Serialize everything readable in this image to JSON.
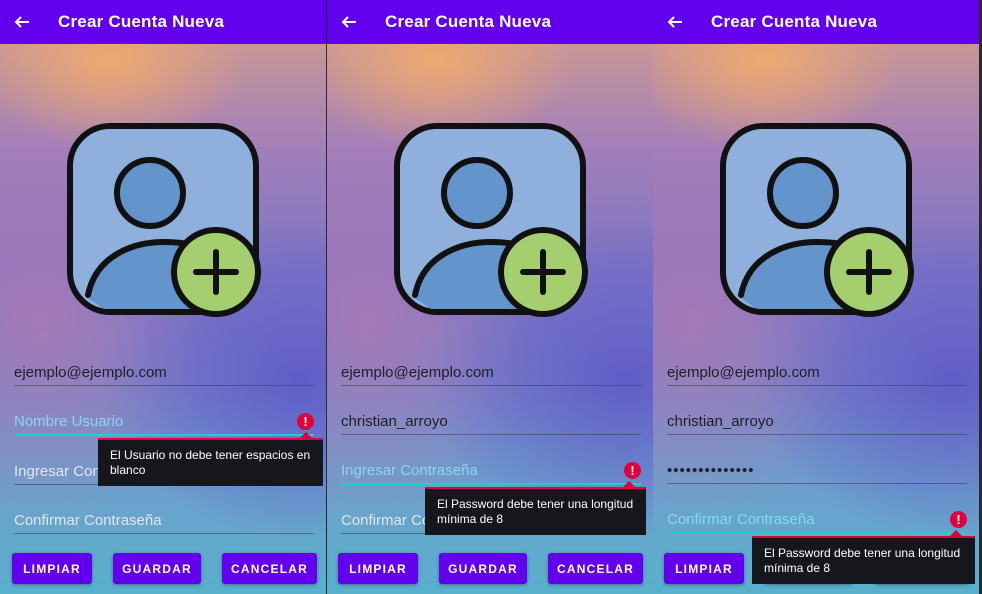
{
  "screens": [
    {
      "title": "Crear Cuenta Nueva",
      "email": "ejemplo@ejemplo.com",
      "username_hint": "Nombre Usuario",
      "password_hint_partial": "Ingresar Con",
      "confirm_hint": "Confirmar Contraseña",
      "error_tooltip": "El Usuario no debe tener espacios en blanco"
    },
    {
      "title": "Crear Cuenta Nueva",
      "email": "ejemplo@ejemplo.com",
      "username": "christian_arroyo",
      "password_hint": "Ingresar Contraseña",
      "confirm_hint_partial": "Confirmar Co",
      "error_tooltip": "El Password debe tener una longitud mínima de 8"
    },
    {
      "title": "Crear Cuenta Nueva",
      "email": "ejemplo@ejemplo.com",
      "username": "christian_arroyo",
      "password_masked": "••••••••••••••",
      "confirm_hint": "Confirmar Contraseña",
      "error_tooltip": "El Password debe tener una longitud mínima de 8"
    }
  ],
  "buttons": {
    "clear": "LIMPIAR",
    "save": "GUARDAR",
    "cancel": "CANCELAR"
  },
  "icons": {
    "back": "arrow-back-icon",
    "avatar": "add-user-icon",
    "error": "error-icon"
  },
  "colors": {
    "appbar": "#6200ee",
    "accent": "#1dd0c8",
    "error": "#e0003c",
    "avatar_bg": "#8fb0dc",
    "avatar_person": "#6494cc",
    "plus_badge": "#a5cf6e"
  }
}
